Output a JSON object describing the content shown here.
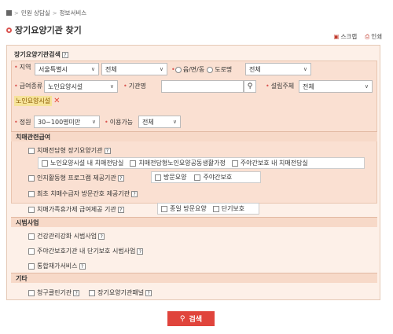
{
  "breadcrumb": [
    "민원 상담실",
    "정보서비스"
  ],
  "page_title": "장기요양기관 찾기",
  "tools": {
    "scrap": "스크랩",
    "print": "인쇄"
  },
  "form_title": "장기요양기관검색",
  "region": {
    "label": "지역",
    "city": "서울특별시",
    "district": "전체"
  },
  "address_type": {
    "opt1": "읍/면/동",
    "opt2": "도로명",
    "value": "전체"
  },
  "benefit": {
    "label": "급여종류",
    "value": "노인요양시설"
  },
  "facility_name": {
    "label": "기관명",
    "value": ""
  },
  "founder": {
    "label": "설립주체",
    "value": "전체"
  },
  "selected_tag": "노인요양시설",
  "capacity": {
    "label": "정원",
    "value": "30~100명미만"
  },
  "availability": {
    "label": "이용가능",
    "value": "전체"
  },
  "sections": {
    "dementia": "치매관련급여",
    "pilot": "시범사업",
    "etc": "기타"
  },
  "dementia": {
    "exclusive": "치매전담형 장기요양기관",
    "exclusive_opts": [
      "노인요양시설 내 치매전담실",
      "치매전담형노인요양공동생활가정",
      "주야간보호 내 치매전담실"
    ],
    "cognitive": "인지활동형 프로그램 제공기관",
    "cognitive_opts": [
      "방문요양",
      "주야간보호"
    ],
    "nursing": "최초 치매수급자 방문간호 제공기관",
    "family": "치매가족휴가제 급여제공 기관",
    "family_opts": [
      "종일 방문요양",
      "단기보호"
    ]
  },
  "pilot": {
    "health": "건강관리강화 시범사업",
    "shortterm": "주야간보호기관 내 단기보호 시범사업",
    "integrated": "통합재가서비스"
  },
  "etc": {
    "clean": "청구클린기관",
    "panel": "장기요양기관패널"
  },
  "search_button": "검색"
}
